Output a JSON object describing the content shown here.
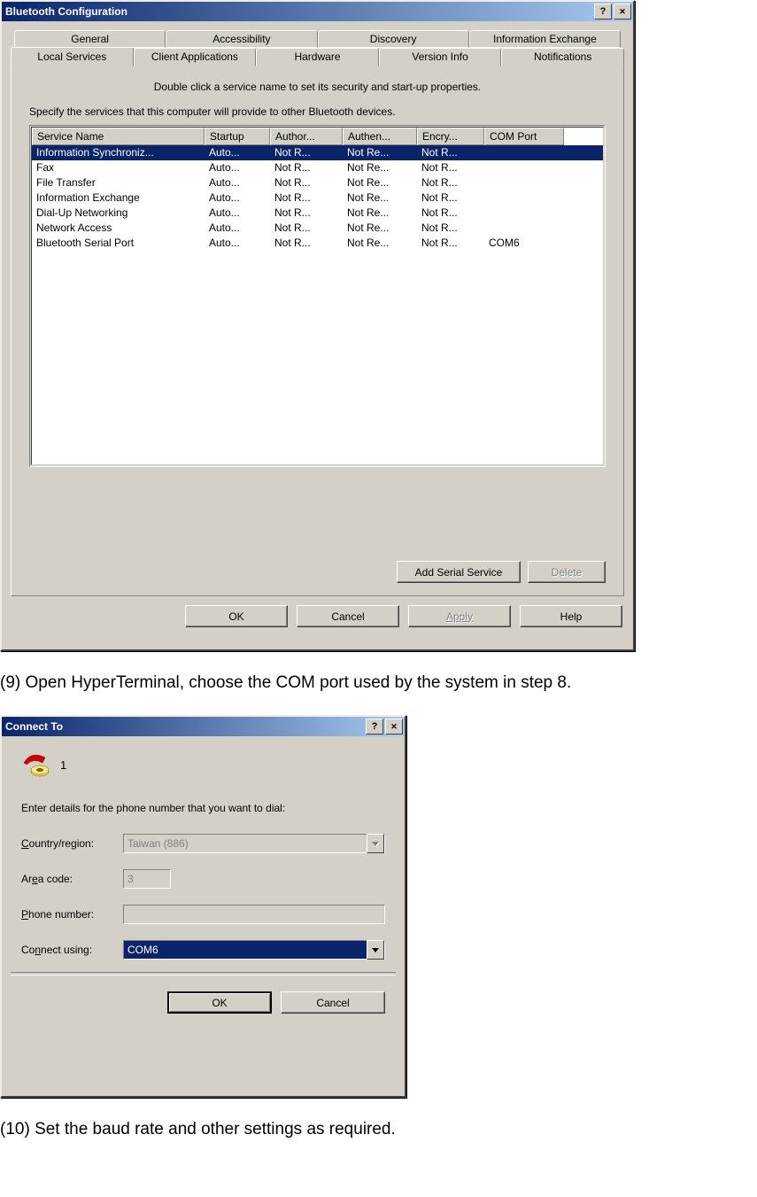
{
  "dialog1": {
    "title": "Bluetooth Configuration",
    "tabs_back": [
      "General",
      "Accessibility",
      "Discovery",
      "Information Exchange"
    ],
    "tabs_front": [
      "Local Services",
      "Client Applications",
      "Hardware",
      "Version Info",
      "Notifications"
    ],
    "active_tab": "Local Services",
    "hint1": "Double click a service name to set its security and start-up properties.",
    "hint2": "Specify the services that this computer will provide to other Bluetooth devices.",
    "columns": [
      "Service Name",
      "Startup",
      "Author...",
      "Authen...",
      "Encry...",
      "COM Port"
    ],
    "rows": [
      {
        "cells": [
          "Information Synchroniz...",
          "Auto...",
          "Not R...",
          "Not Re...",
          "Not R...",
          ""
        ],
        "selected": true
      },
      {
        "cells": [
          "Fax",
          "Auto...",
          "Not R...",
          "Not Re...",
          "Not R...",
          ""
        ],
        "selected": false
      },
      {
        "cells": [
          "File Transfer",
          "Auto...",
          "Not R...",
          "Not Re...",
          "Not R...",
          ""
        ],
        "selected": false
      },
      {
        "cells": [
          "Information Exchange",
          "Auto...",
          "Not R...",
          "Not Re...",
          "Not R...",
          ""
        ],
        "selected": false
      },
      {
        "cells": [
          "Dial-Up Networking",
          "Auto...",
          "Not R...",
          "Not Re...",
          "Not R...",
          ""
        ],
        "selected": false
      },
      {
        "cells": [
          "Network Access",
          "Auto...",
          "Not R...",
          "Not Re...",
          "Not R...",
          ""
        ],
        "selected": false
      },
      {
        "cells": [
          "Bluetooth Serial Port",
          "Auto...",
          "Not R...",
          "Not Re...",
          "Not R...",
          "COM6"
        ],
        "selected": false
      }
    ],
    "add_btn": "Add Serial Service",
    "delete_btn": "Delete",
    "ok": "OK",
    "cancel": "Cancel",
    "apply": "Apply",
    "help": "Help"
  },
  "step9": "(9)  Open HyperTerminal, choose the COM port used by the system in step 8.",
  "dialog2": {
    "title": "Connect To",
    "conn_name": "1",
    "instr": "Enter details for the phone number that you want to dial:",
    "labels": {
      "country_pre": "C",
      "country_mid": "ountry/region:",
      "area_pre": "Ar",
      "area_u": "e",
      "area_post": "a code:",
      "phone_pre": "P",
      "phone_post": "hone number:",
      "connect_pre": "Co",
      "connect_u": "n",
      "connect_post": "nect using:"
    },
    "country": "Taiwan (886)",
    "area": "3",
    "phone": "",
    "connect": "COM6",
    "ok": "OK",
    "cancel": "Cancel"
  },
  "step10": "(10)  Set the baud rate and other settings as required."
}
